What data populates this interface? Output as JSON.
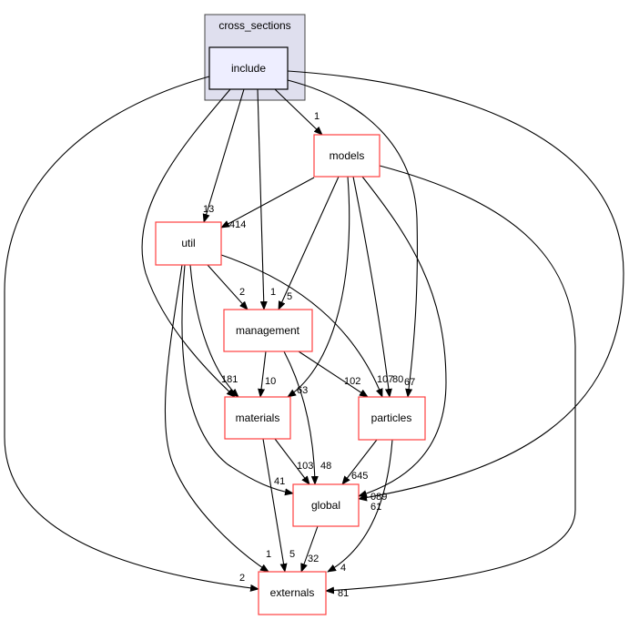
{
  "cluster": {
    "label": "cross_sections",
    "fill": "#dfdfee"
  },
  "nodes": {
    "include": "include",
    "models": "models",
    "util": "util",
    "management": "management",
    "materials": "materials",
    "particles": "particles",
    "global": "global",
    "externals": "externals"
  },
  "colors": {
    "node_border": "#ff4040",
    "include_fill": "#eeeeff"
  },
  "edges": [
    {
      "from": "include",
      "to": "models",
      "label": "1"
    },
    {
      "from": "include",
      "to": "util",
      "label": "13"
    },
    {
      "from": "include",
      "to": "management",
      "label": "1"
    },
    {
      "from": "include",
      "to": "materials",
      "label": "181"
    },
    {
      "from": "include",
      "to": "particles",
      "label": "67"
    },
    {
      "from": "include",
      "to": "global",
      "label": "089"
    },
    {
      "from": "include",
      "to": "externals",
      "label": "2"
    },
    {
      "from": "models",
      "to": "util",
      "label": "414"
    },
    {
      "from": "models",
      "to": "management",
      "label": "5"
    },
    {
      "from": "models",
      "to": "materials",
      "label": "63"
    },
    {
      "from": "models",
      "to": "particles",
      "label": "80"
    },
    {
      "from": "models",
      "to": "global",
      "label": "61"
    },
    {
      "from": "models",
      "to": "externals",
      "label": "81"
    },
    {
      "from": "util",
      "to": "management",
      "label": "2"
    },
    {
      "from": "util",
      "to": "global",
      "label": "41"
    },
    {
      "from": "util",
      "to": "externals",
      "label": "1"
    },
    {
      "from": "util",
      "to": "particles",
      "label": "107"
    },
    {
      "from": "management",
      "to": "materials",
      "label": "10"
    },
    {
      "from": "management",
      "to": "global",
      "label": "48"
    },
    {
      "from": "management",
      "to": "particles",
      "label": "102"
    },
    {
      "from": "materials",
      "to": "global",
      "label": "103"
    },
    {
      "from": "materials",
      "to": "externals",
      "label": "5"
    },
    {
      "from": "particles",
      "to": "global",
      "label": "645"
    },
    {
      "from": "particles",
      "to": "externals",
      "label": "4"
    },
    {
      "from": "global",
      "to": "externals",
      "label": "32"
    }
  ]
}
